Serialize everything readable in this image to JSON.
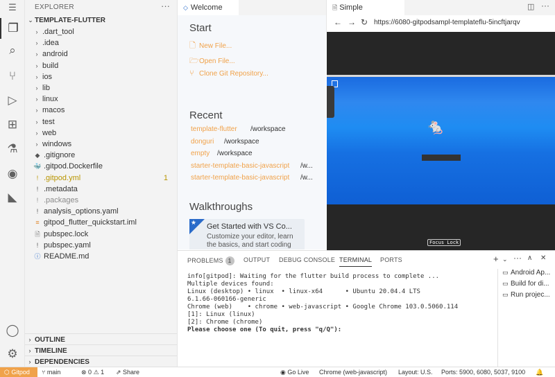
{
  "explorer": {
    "title": "EXPLORER",
    "project": "TEMPLATE-FLUTTER",
    "items": [
      {
        "label": ".dart_tool",
        "type": "folder"
      },
      {
        "label": ".idea",
        "type": "folder"
      },
      {
        "label": "android",
        "type": "folder"
      },
      {
        "label": "build",
        "type": "folder"
      },
      {
        "label": "ios",
        "type": "folder"
      },
      {
        "label": "lib",
        "type": "folder"
      },
      {
        "label": "linux",
        "type": "folder"
      },
      {
        "label": "macos",
        "type": "folder"
      },
      {
        "label": "test",
        "type": "folder"
      },
      {
        "label": "web",
        "type": "folder"
      },
      {
        "label": "windows",
        "type": "folder"
      },
      {
        "label": ".gitignore",
        "type": "file"
      },
      {
        "label": ".gitpod.Dockerfile",
        "type": "file"
      },
      {
        "label": ".gitpod.yml",
        "type": "file",
        "badge": "1"
      },
      {
        "label": ".metadata",
        "type": "file"
      },
      {
        "label": ".packages",
        "type": "file"
      },
      {
        "label": "analysis_options.yaml",
        "type": "file"
      },
      {
        "label": "gitpod_flutter_quickstart.iml",
        "type": "file"
      },
      {
        "label": "pubspec.lock",
        "type": "file"
      },
      {
        "label": "pubspec.yaml",
        "type": "file"
      },
      {
        "label": "README.md",
        "type": "file"
      }
    ],
    "sections": [
      "OUTLINE",
      "TIMELINE",
      "DEPENDENCIES"
    ]
  },
  "welcome": {
    "tab": "Welcome",
    "start_heading": "Start",
    "start_links": [
      "New File...",
      "Open File...",
      "Clone Git Repository..."
    ],
    "recent_heading": "Recent",
    "recent": [
      {
        "name": "template-flutter",
        "path": "/workspace"
      },
      {
        "name": "donguri",
        "path": "/workspace"
      },
      {
        "name": "empty",
        "path": "/workspace"
      },
      {
        "name": "starter-template-basic-javascript",
        "path": "/w..."
      },
      {
        "name": "starter-template-basic-javascript",
        "path": "/w..."
      }
    ],
    "walkthroughs_heading": "Walkthroughs",
    "walkthrough": {
      "title": "Get Started with VS Co...",
      "desc_line1": "Customize your editor, learn",
      "desc_line2": "the basics, and start coding"
    }
  },
  "browser": {
    "tab": "Simple Browser",
    "url": "https://6080-gitpodsampl-templateflu-5incftjarqv",
    "focus_lock": "Focus Lock"
  },
  "panel": {
    "tabs": [
      "PROBLEMS",
      "OUTPUT",
      "DEBUG CONSOLE",
      "TERMINAL",
      "PORTS"
    ],
    "problems_count": "1",
    "terminal_lines": [
      "info[gitpod]: Waiting for the flutter build process to complete ...",
      "Multiple devices found:",
      "Linux (desktop) • linux  • linux-x64      • Ubuntu 20.04.4 LTS",
      "6.1.66-060166-generic",
      "Chrome (web)    • chrome • web-javascript • Google Chrome 103.0.5060.114",
      "[1]: Linux (linux)",
      "[2]: Chrome (chrome)"
    ],
    "terminal_prompt": "Please choose one (To quit, press \"q/Q\"):",
    "terminal_list": [
      "Android Ap...",
      "Build for di...",
      "Run projec..."
    ]
  },
  "status": {
    "gitpod": "Gitpod",
    "branch": "main",
    "errors": "0",
    "warnings": "1",
    "share": "Share",
    "go_live": "Go Live",
    "device": "Chrome (web-javascript)",
    "layout": "Layout: U.S.",
    "ports": "Ports: 5900, 6080, 5037, 9100"
  },
  "colors": {
    "accent": "#f0a24a",
    "link": "#f0a24a",
    "desktop_blue": "#1e8cf2"
  }
}
